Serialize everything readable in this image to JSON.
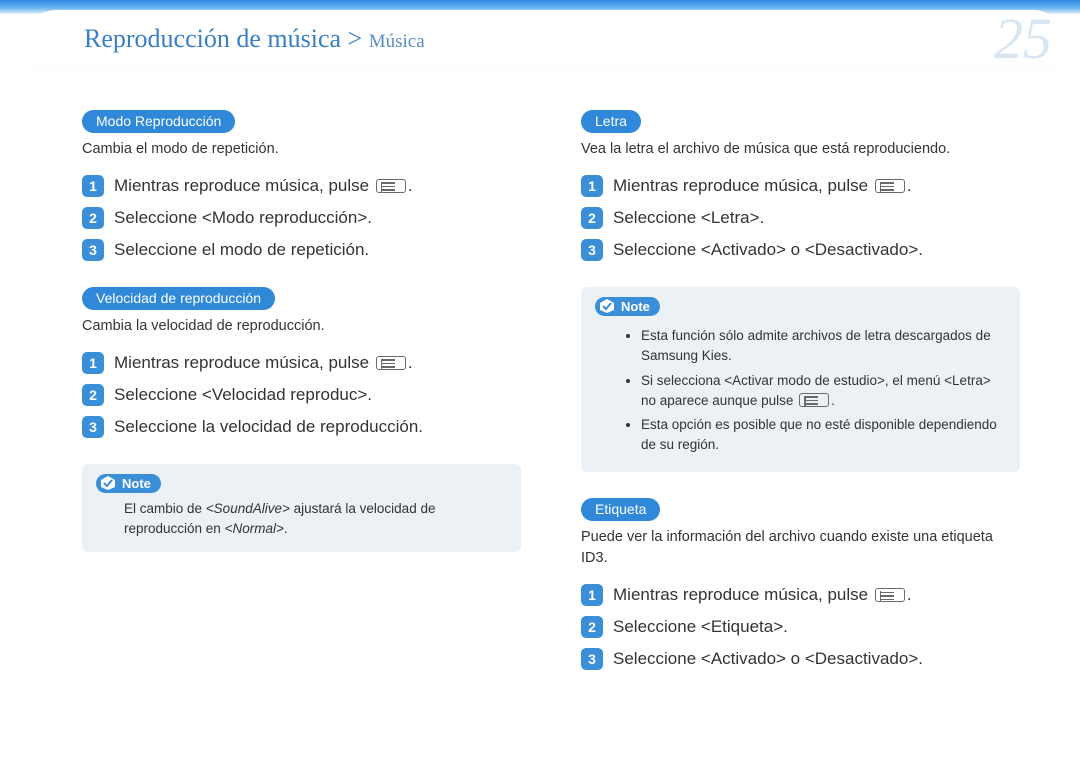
{
  "header": {
    "breadcrumb_main": "Reproducción de música",
    "breadcrumb_sep": " > ",
    "breadcrumb_sub": "Música",
    "page_number": "25"
  },
  "left": {
    "playmode": {
      "pill": "Modo Reproducción",
      "desc": "Cambia el modo de repetición.",
      "steps": [
        "Mientras reproduce música, pulse ",
        "Seleccione <Modo reproducción>.",
        "Seleccione el modo de repetición."
      ]
    },
    "speed": {
      "pill": "Velocidad de reproducción",
      "desc": "Cambia la velocidad de reproducción.",
      "steps": [
        "Mientras reproduce música, pulse ",
        "Seleccione <Velocidad reproduc>.",
        "Seleccione la velocidad de reproducción."
      ],
      "note_label": "Note",
      "note_prefix": "El cambio de ",
      "note_italic1": "<SoundAlive>",
      "note_mid": " ajustará la velocidad de reproducción en ",
      "note_italic2": "<Normal>",
      "note_suffix": "."
    }
  },
  "right": {
    "lyrics": {
      "pill": "Letra",
      "desc": "Vea la letra el archivo de música que está reproduciendo.",
      "steps": [
        "Mientras reproduce música, pulse ",
        "Seleccione <Letra>.",
        "Seleccione <Activado> o <Desactivado>."
      ],
      "note_label": "Note",
      "note_bullets": [
        "Esta función sólo admite archivos de letra descargados de Samsung Kies.",
        "Si selecciona <Activar modo de estudio>, el menú <Letra> no aparece aunque pulse ",
        "Esta opción es posible que no esté disponible dependiendo de su región."
      ]
    },
    "tag": {
      "pill": "Etiqueta",
      "desc": "Puede ver la información del archivo cuando existe una etiqueta ID3.",
      "steps": [
        "Mientras reproduce música, pulse ",
        "Seleccione <Etiqueta>.",
        "Seleccione <Activado> o <Desactivado>."
      ]
    }
  }
}
